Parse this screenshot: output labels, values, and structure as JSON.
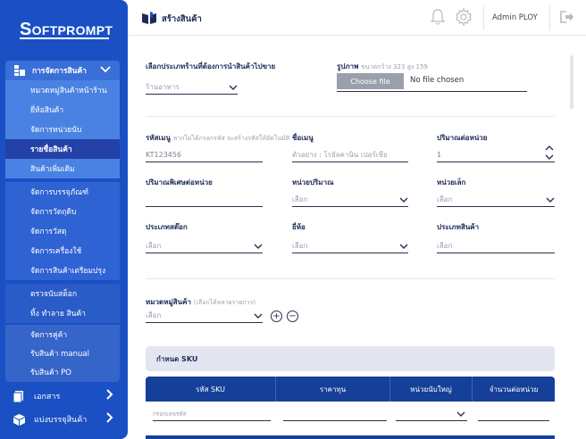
{
  "brand": {
    "logo_text": "OFTPROMPT",
    "logo_initial": "S"
  },
  "sidebar": {
    "section_label": "การจัดการสินค้า",
    "items": [
      {
        "label": "หมวดหมู่สินค้าหน้าร้าน"
      },
      {
        "label": "ยี่ห้อสินค้า"
      },
      {
        "label": "จัดการหน่วยนับ"
      },
      {
        "label": "รายชื่อสินค้า",
        "active": true
      },
      {
        "label": "สินค้าเพิ่มเติม"
      },
      {
        "label": "จัดการบรรจุภัณฑ์"
      },
      {
        "label": "จัดการวัตถุดิบ"
      },
      {
        "label": "จัดการวัสดุ"
      },
      {
        "label": "จัดการเครื่องใช้"
      },
      {
        "label": "จัดการสินค้าเตรียมปรุง"
      },
      {
        "label": "ตรวจนับสต็อก"
      },
      {
        "label": "ทิ้ง ทำลาย สินค้า"
      },
      {
        "label": "จัดการคู่ค้า"
      },
      {
        "label": "รับสินค้า manual"
      },
      {
        "label": "รับสินค้า PO"
      }
    ],
    "bottom": [
      {
        "label": "เอกสาร",
        "icon": "document-icon"
      },
      {
        "label": "แบ่งบรรจุสินค้า",
        "icon": "box-icon"
      }
    ]
  },
  "header": {
    "title": "สร้างสินค้า",
    "user": "Admin PLOY"
  },
  "form": {
    "store_type": {
      "label": "เลือกประเภทร้านที่ต้องการนำสินค้าไปขาย",
      "value": "ร้านอาหาร"
    },
    "image": {
      "label": "รูปภาพ",
      "hint": "ขนาดกว้าง 323 สูง 159",
      "button": "Choose file",
      "status": "No file chosen"
    },
    "sku_code": {
      "label": "รหัสเมนู",
      "hint": "หากไม่ได้กรอกรหัส จะสร้างรหัสให้อัตโนมัติ",
      "value": "KT123456"
    },
    "menu_name": {
      "label": "ชื่อเมนู",
      "placeholder": "ตัวอย่าง : โรยัลคานิน เปอร์เซีย"
    },
    "qty_per_unit": {
      "label": "ปริมาณต่อหน่วย",
      "value": "1"
    },
    "special_qty": {
      "label": "ปริมาณพิเศษต่อหน่วย",
      "value": ""
    },
    "qty_unit": {
      "label": "หน่วยปริมาณ",
      "value": "เลือก"
    },
    "small_unit": {
      "label": "หน่วยเล็ก",
      "value": "เลือก"
    },
    "stock_type": {
      "label": "ประเภทสต๊อก",
      "value": "เลือก"
    },
    "brand": {
      "label": "ยี่ห้อ",
      "value": "เลือก"
    },
    "product_type": {
      "label": "ประเภทสินค้า",
      "value": "เลือก"
    },
    "category": {
      "label": "หมวดหมู่สินค้า",
      "hint": "(เลือกได้หลายรายการ)",
      "value": "เลือก"
    }
  },
  "sku": {
    "section_title": "กำหนด SKU",
    "columns": [
      "รหัส SKU",
      "ราคาทุน",
      "หน่วยนับใหญ่",
      "จำนวนต่อหน่วย"
    ],
    "row": {
      "code_placeholder": "กรอกเลขรหัส"
    }
  },
  "colors": {
    "sidebar": "#1a50c4",
    "table_header": "#163f99",
    "active_item": "#2342a8"
  }
}
